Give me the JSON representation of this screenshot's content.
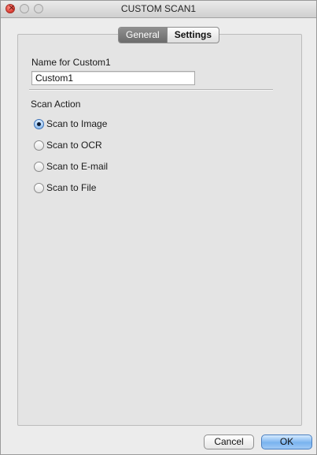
{
  "window": {
    "title": "CUSTOM SCAN1"
  },
  "tabs": [
    {
      "label": "General",
      "active": true
    },
    {
      "label": "Settings",
      "active": false
    }
  ],
  "name_section": {
    "label": "Name for Custom1",
    "value": "Custom1"
  },
  "scan_action": {
    "label": "Scan Action",
    "options": [
      {
        "label": "Scan to Image",
        "selected": true
      },
      {
        "label": "Scan to OCR",
        "selected": false
      },
      {
        "label": "Scan to E-mail",
        "selected": false
      },
      {
        "label": "Scan to File",
        "selected": false
      }
    ]
  },
  "buttons": {
    "cancel": "Cancel",
    "ok": "OK"
  },
  "colors": {
    "accent": "#79b3ef",
    "close": "#e0443a"
  }
}
